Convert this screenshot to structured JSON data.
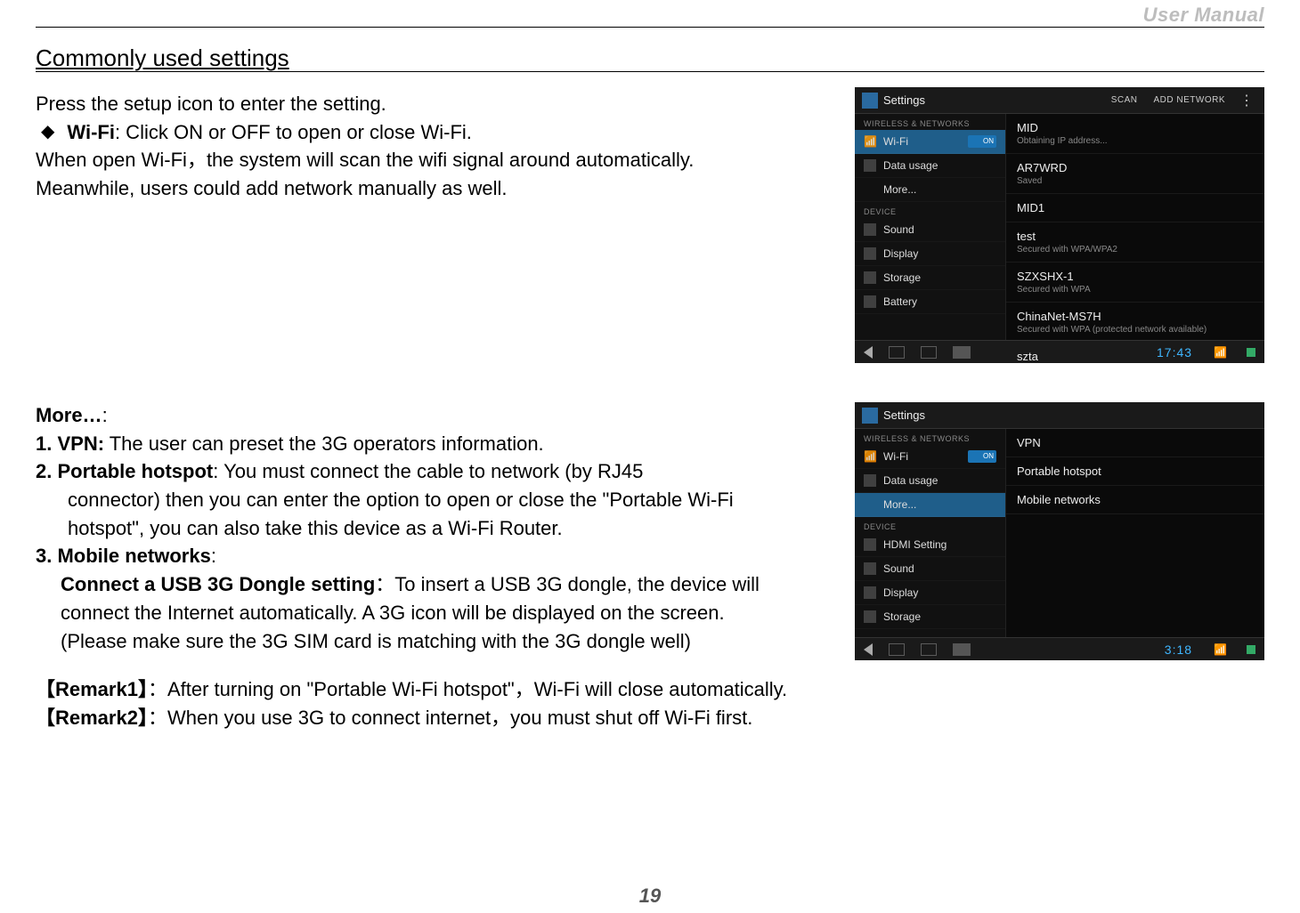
{
  "header": {
    "doc_title": "User Manual"
  },
  "section": {
    "title": "Commonly used settings"
  },
  "block1": {
    "line1": "Press the setup icon to enter the setting.",
    "bullet_lead": "◆",
    "wifi_label": "Wi-Fi",
    "wifi_rest": ": Click ON or OFF to open or close Wi-Fi.",
    "line3": "When open Wi-Fi，the system will scan the wifi signal around automatically.",
    "line4": "Meanwhile, users could add network manually as well."
  },
  "block2": {
    "more_label": "More…",
    "more_colon": ":",
    "item1_num": "1. ",
    "item1_b": "VPN:",
    "item1_rest": " The user can preset the 3G operators information.",
    "item2_num": "2. ",
    "item2_b": "Portable hotspot",
    "item2_rest": ": You must connect the cable to network (by RJ45",
    "item2_l2": "connector) then you can enter the option to open or close the \"Portable Wi-Fi",
    "item2_l3": "hotspot\", you can also take this device as a Wi-Fi Router.",
    "item3_num": "3. ",
    "item3_b": "Mobile networks",
    "item3_colon": ":",
    "item3_sub_b": "Connect a USB 3G Dongle setting",
    "item3_sub_rest": "：To insert a USB 3G dongle, the device will",
    "item3_l2": "connect the Internet automatically. A 3G icon will be displayed on the screen.",
    "item3_l3": "(Please make sure the 3G SIM card is matching with the 3G dongle well)"
  },
  "remarks": {
    "r1_b": "【Remark1】",
    "r1_rest": "：After turning on \"Portable Wi-Fi hotspot\"，Wi-Fi will close automatically.",
    "r2_b": "【Remark2】",
    "r2_rest": "：When you use 3G to connect internet，you must shut off Wi-Fi first."
  },
  "page_number": "19",
  "shot1": {
    "title": "Settings",
    "action_scan": "SCAN",
    "action_add": "ADD NETWORK",
    "cat_wireless": "WIRELESS & NETWORKS",
    "cat_device": "DEVICE",
    "left": {
      "wifi": "Wi-Fi",
      "wifi_toggle": "ON",
      "data_usage": "Data usage",
      "more": "More...",
      "sound": "Sound",
      "display": "Display",
      "storage": "Storage",
      "battery": "Battery"
    },
    "right": [
      {
        "t1": "MID",
        "t2": "Obtaining IP address..."
      },
      {
        "t1": "AR7WRD",
        "t2": "Saved"
      },
      {
        "t1": "MID1",
        "t2": ""
      },
      {
        "t1": "test",
        "t2": "Secured with WPA/WPA2"
      },
      {
        "t1": "SZXSHX-1",
        "t2": "Secured with WPA"
      },
      {
        "t1": "ChinaNet-MS7H",
        "t2": "Secured with WPA (protected network available)"
      },
      {
        "t1": "szta",
        "t2": ""
      }
    ],
    "clock": "17:43"
  },
  "shot2": {
    "title": "Settings",
    "cat_wireless": "WIRELESS & NETWORKS",
    "cat_device": "DEVICE",
    "left": {
      "wifi": "Wi-Fi",
      "wifi_toggle": "ON",
      "data_usage": "Data usage",
      "more": "More...",
      "hdmi": "HDMI Setting",
      "sound": "Sound",
      "display": "Display",
      "storage": "Storage"
    },
    "right": [
      {
        "t1": "VPN"
      },
      {
        "t1": "Portable hotspot"
      },
      {
        "t1": "Mobile networks"
      }
    ],
    "clock": "3:18"
  }
}
